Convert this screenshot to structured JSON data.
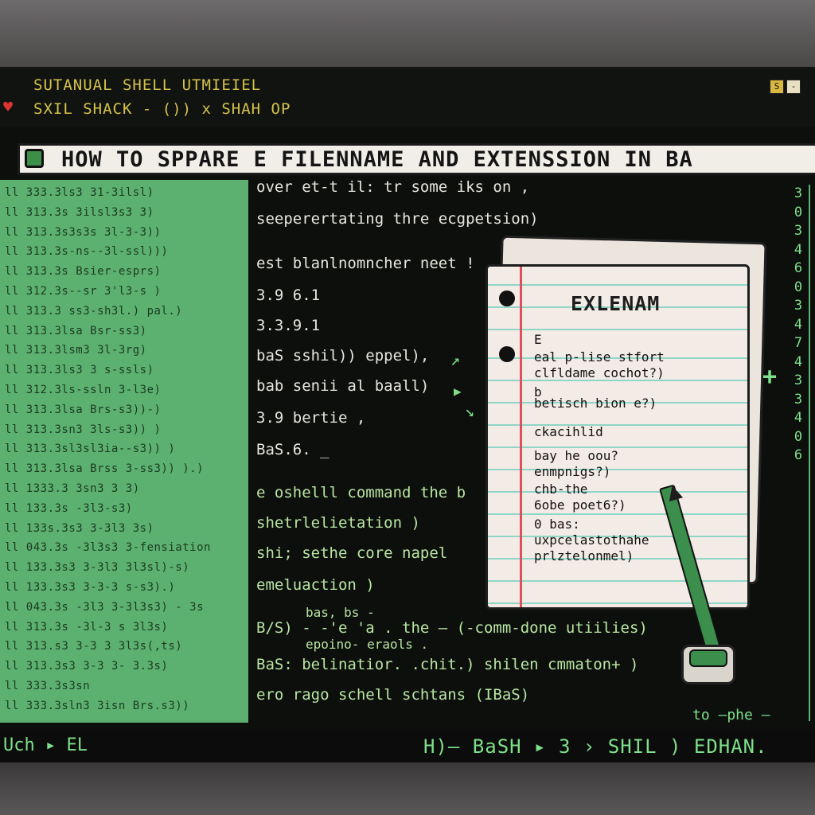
{
  "window": {
    "title_line_1": "SUTANUAL SHELL UTMIEIEL",
    "title_line_2": "SXIL SHACK - ()) x SHAH OP",
    "heart_icon": "heart-icon",
    "controls": [
      "S",
      "-"
    ]
  },
  "banner": {
    "title": "HOW TO SPPARE E FILENNAME AND  EXTENSSION IN BA"
  },
  "left_pane": {
    "lines": [
      "ll 333.3ls3 31-3ilsl)",
      "ll 313.3s 3ilsl3s3 3)",
      "ll 313.3s3s3s 3l-3-3))",
      "ll 313.3s-ns--3l-ssl)))",
      "ll 313.3s Bsier-esprs)",
      "ll 312.3s--sr 3'l3-s )",
      "ll 313.3 ss3-sh3l.) pal.)",
      "ll 313.3lsa Bsr-ss3)",
      "ll 313.3lsm3 3l-3rg)",
      "ll 313.3ls3 3 s-ssls)",
      "ll 312.3ls-ssln 3-l3e)",
      "ll 313.3lsa Brs-s3))-)",
      "ll 313.3sn3 3ls-s3)) )",
      "ll 313.3sl3sl3ia--s3)) )",
      "ll 313.3lsa Brss 3-ss3)) ).)",
      "ll 1333.3 3sn3 3 3)",
      "ll 133.3s -3l3-s3)",
      "ll 133s.3s3 3-3l3 3s)",
      "ll 043.3s -3l3s3 3-fensiation",
      "ll 133.3s3 3-3l3 3l3sl)-s)",
      "ll 133.3s3 3-3-3 s-s3).)",
      "ll 043.3s -3l3 3-3l3s3) - 3s",
      "ll 313.3s -3l-3 s 3l3s)",
      "ll 313.s3 3-3 3 3l3s(,ts)",
      "ll 313.3s3 3-3 3- 3.3s)",
      "ll 333.3s3sn",
      "ll 333.3sln3 3isn Brs.s3))"
    ]
  },
  "center_text": {
    "lines": [
      "over et-t il: tr some iks on ,",
      "seeperertating thre ecgpetsion)",
      "est blanlnomncher neet !",
      "3.9 6.1",
      "3.3.9.1",
      "baS sshil)) eppel),",
      "bab senii al baall)",
      "3.9 bertie ,",
      "BaS.6. _",
      "e oshelll command the b",
      "shetrlelietation )",
      "shi; sethe core napel",
      "emeluaction )",
      "bas, bs -",
      "B/S) - -'e 'a . the — (-comm-done utiilies)",
      "epoino- eraols .",
      "BaS: belinatior. .chit.) shilen cmmaton+ )",
      "ero rago schell schtans (IBaS)"
    ]
  },
  "notebook": {
    "title": "EXLENAM",
    "lines": [
      "E",
      "eal p-lise stfort",
      "clfldame cochot?)",
      "b",
      "betisch bion e?)",
      "ckacihlid",
      "bay he oou?",
      "enmpnigs?)",
      "chb-the",
      "6obe poet6?)",
      "0 bas:",
      "uxpcelastothahe",
      "prlztelonmel)"
    ]
  },
  "right_column": {
    "digits": [
      "3",
      "0",
      "3",
      "4",
      "6",
      "0",
      "3",
      "4",
      "7",
      "4",
      "3",
      "3",
      "4",
      "0",
      "6"
    ],
    "plus": "+"
  },
  "side_note": "to —phe —",
  "status_bar": {
    "left": "Uch ▸ EL",
    "right": "H)— BaSH ▸ 3 › SHIL ) EDHAN."
  },
  "colors": {
    "terminal_bg": "#0d0f0d",
    "pane_green": "#5cb170",
    "accent_green": "#7ee08a",
    "title_yellow": "#d4c34a",
    "notebook_paper": "#f3ebe6",
    "notebook_margin": "#e0505a"
  }
}
